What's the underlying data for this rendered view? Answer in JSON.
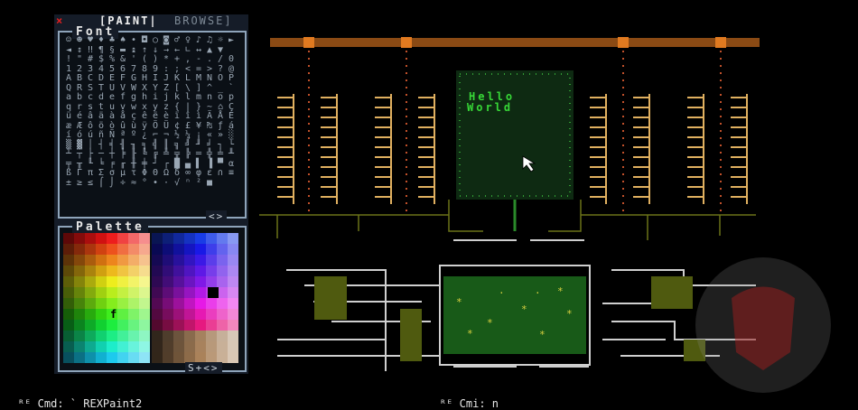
{
  "menu": {
    "close_glyph": "×",
    "paint": "[PAINT|",
    "browse": "BROWSE]"
  },
  "font_panel": {
    "title": "Font",
    "nav": "<>"
  },
  "palette_panel": {
    "title": "Palette",
    "nav": "S+<>",
    "selected_glyph": "f"
  },
  "canvas": {
    "text_line1": "Hello",
    "text_line2": "World"
  },
  "status": {
    "left": "ᴿᴱ Cmd: ` REXPaint2",
    "right": "ᴿᴱ Cmi: n"
  },
  "colors": {
    "bus": "#8a4a14",
    "node": "#e07a20",
    "chip_fill": "#0e2a12",
    "chip_dots": "#3fbf3f",
    "board": "#185a18",
    "wire": "#cfcfcf",
    "olive": "#4f5a0f",
    "ladder": "#e0b060",
    "text_green": "#37d837"
  },
  "font_glyphs": "☺☻♥♦♣♠•◘○◙♂♀♪♫☼►◄↕‼¶§▬↨↑↓→←∟↔▲▼ !\"#$%&'()*+,-./0123456789:;<=>?@ABCDEFGHIJKLMNOPQRSTUVWXYZ[\\]^_`abcdefghijklmnopqrstuvwxyz{|}~⌂ÇüéâäàåçêëèïîìÄÅÉæÆôöòûùÿÖÜ¢£¥₧ƒáíóúñÑªº¿⌐¬½¼¡«»░▒▓│┤╡╢╖╕╣║╗╝╜╛┐└┴┬├─┼╞╟╚╔╩╦╠═╬╧╨╤╥╙╘╒╓╫╪┘┌█▄▌▐▀αßΓπΣσµτΦΘΩδ∞φε∩≡±≥≤⌠⌡÷≈°∙·√ⁿ²■ "
}
